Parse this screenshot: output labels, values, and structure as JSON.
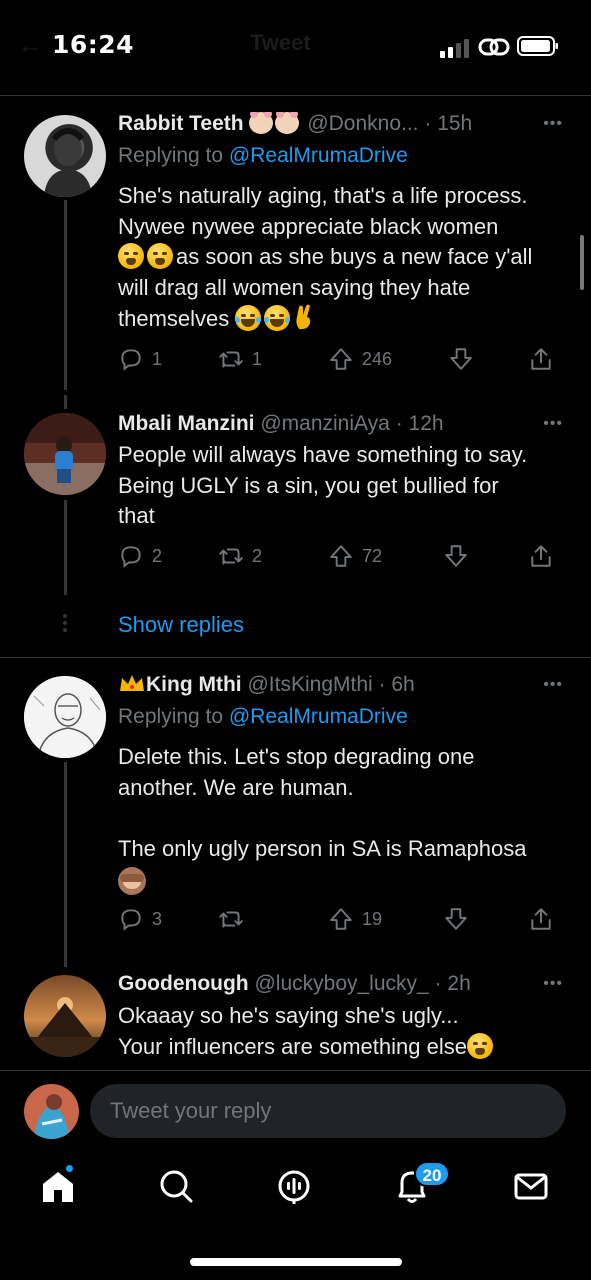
{
  "status_bar": {
    "time": "16:24"
  },
  "header": {
    "title": "Tweet"
  },
  "tweets": [
    {
      "name": "Rabbit Teeth",
      "handle": "@Donkno...",
      "time": "· 15h",
      "replying_label": "Replying to",
      "replying_to": "@RealMrumaDrive",
      "body_lines": [
        "She's naturally aging, that's a life process.",
        "Nywee nywee appreciate black women",
        "as soon as she buys a new face y'all",
        "will drag all women saying they hate",
        "themselves"
      ],
      "replies": "1",
      "retweets": "1",
      "upvotes": "246"
    },
    {
      "name": "Mbali Manzini",
      "handle": "@manziniAya",
      "time": "· 12h",
      "body": "People will always have something to say.\nBeing UGLY is a sin, you get bullied for\nthat",
      "replies": "2",
      "retweets": "2",
      "upvotes": "72"
    },
    {
      "name": "King Mthi",
      "handle": "@ItsKingMthi",
      "time": "· 6h",
      "replying_label": "Replying to",
      "replying_to": "@RealMrumaDrive",
      "body": "Delete this. Let's stop degrading one\nanother. We are human.\n\nThe only ugly person in SA is Ramaphosa",
      "replies": "3",
      "retweets": "",
      "upvotes": "19"
    },
    {
      "name": "Goodenough",
      "handle": "@luckyboy_lucky_",
      "time": "· 2h",
      "body_line1": "Okaaay so he's saying she's ugly...",
      "body_line2": "Your influencers are something else"
    }
  ],
  "show_replies": "Show replies",
  "reply_bar": {
    "placeholder": "Tweet your reply"
  },
  "tabbar": {
    "notifications_badge": "20"
  },
  "colors": {
    "accent": "#1d9bf0",
    "background": "#000000",
    "secondary_text": "#71767b"
  },
  "icons": [
    "reply-icon",
    "retweet-icon",
    "upvote-icon",
    "downvote-icon",
    "share-icon",
    "home-icon",
    "search-icon",
    "spaces-icon",
    "notifications-icon",
    "messages-icon"
  ]
}
